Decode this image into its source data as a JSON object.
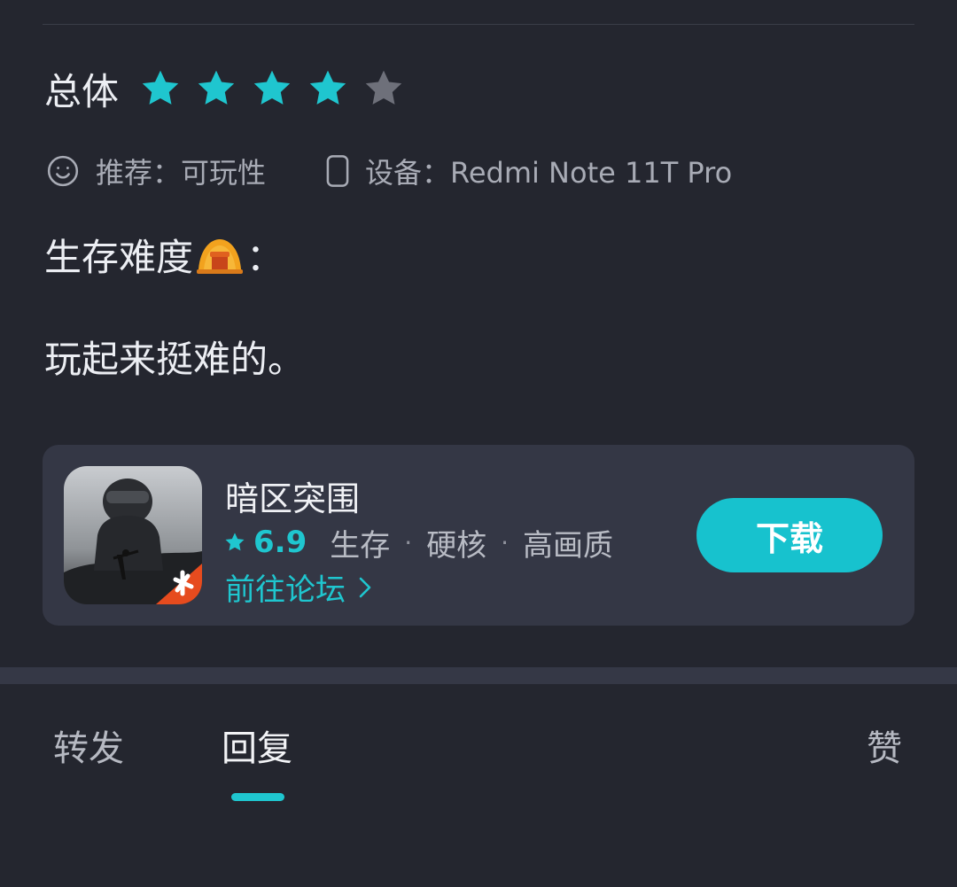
{
  "review": {
    "rating_label": "总体",
    "rating": {
      "value": 4,
      "max": 5
    },
    "recommend_text": "推荐：可玩性",
    "device_text": "设备：Redmi Note 11T Pro",
    "line1_prefix": "生存难度",
    "line1_emoji": "tent-emoji",
    "line1_suffix": "：",
    "line2": "玩起来挺难的。"
  },
  "game_card": {
    "name": "暗区突围",
    "score": "6.9",
    "tags": [
      "生存",
      "硬核",
      "高画质"
    ],
    "tag_separator": "·",
    "forum_link": "前往论坛",
    "download_label": "下载"
  },
  "bottom_tabs": {
    "forward": "转发",
    "reply": "回复",
    "like": "赞",
    "active": "reply"
  },
  "colors": {
    "background": "#24262f",
    "card": "#343745",
    "accent": "#1fc6cf",
    "star_filled": "#1fc6cf",
    "star_empty": "#6e707a"
  }
}
